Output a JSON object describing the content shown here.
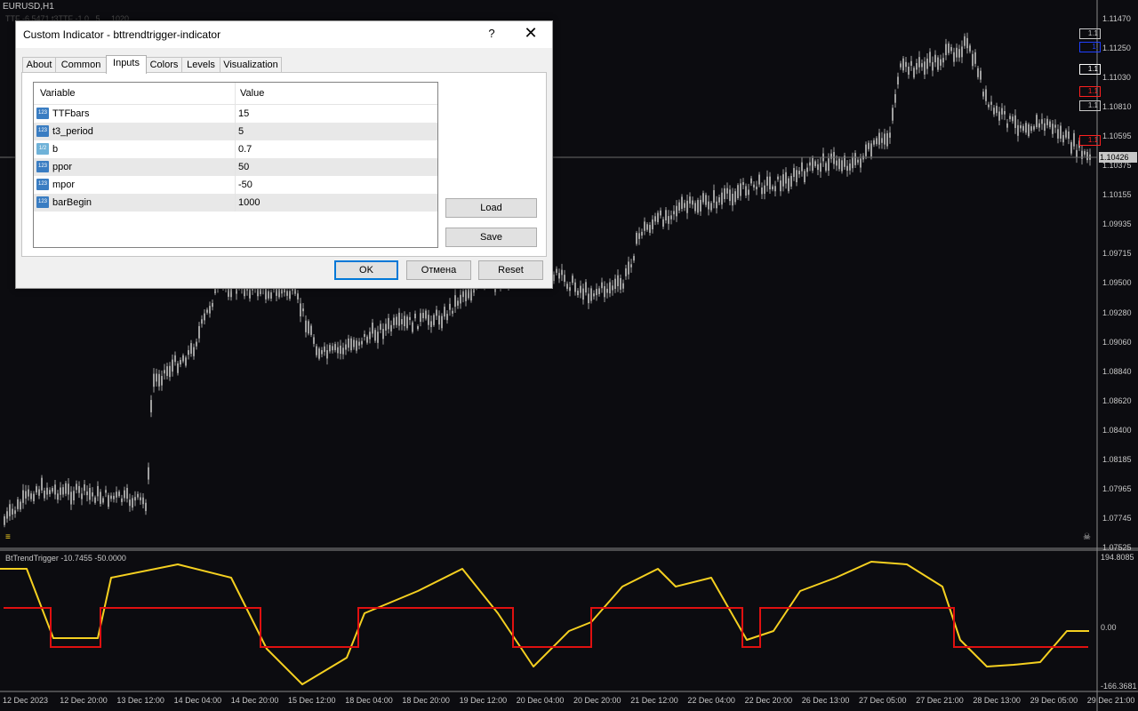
{
  "window": {
    "title": "EURUSD,H1",
    "faint_info": "TTF  -6.5471  t3TTF  -1.0...5  ...  1020"
  },
  "price_axis": [
    "1.11470",
    "1.11250",
    "1.11030",
    "1.10810",
    "1.10595",
    "1.10375",
    "1.10155",
    "1.09935",
    "1.09715",
    "1.09500",
    "1.09280",
    "1.09060",
    "1.08840",
    "1.08620",
    "1.08400",
    "1.08185",
    "1.07965",
    "1.07745",
    "1.07525"
  ],
  "current_price": "1.10426",
  "tags": [
    {
      "text": "1.1",
      "color": "#c8c8c8"
    },
    {
      "text": "1.",
      "color": "#2040ff"
    },
    {
      "text": "1.1",
      "color": "#ffffff"
    },
    {
      "text": "1.1",
      "color": "#ff2020"
    },
    {
      "text": "1.1",
      "color": "#c8c8c8"
    },
    {
      "text": "1.1",
      "color": "#ff2020"
    }
  ],
  "time_axis": [
    "12 Dec 2023",
    "12 Dec 20:00",
    "13 Dec 12:00",
    "14 Dec 04:00",
    "14 Dec 20:00",
    "15 Dec 12:00",
    "18 Dec 04:00",
    "18 Dec 20:00",
    "19 Dec 12:00",
    "20 Dec 04:00",
    "20 Dec 20:00",
    "21 Dec 12:00",
    "22 Dec 04:00",
    "22 Dec 20:00",
    "26 Dec 13:00",
    "27 Dec 05:00",
    "27 Dec 21:00",
    "28 Dec 13:00",
    "29 Dec 05:00",
    "29 Dec 21:00"
  ],
  "subwindow": {
    "title": "BtTrendTrigger -10.7455 -50.0000",
    "max_label": "194.8085",
    "zero_label": "0.00",
    "min_label": "-166.3681"
  },
  "colors": {
    "background": "#0c0c10",
    "candle": "#a0a0a0",
    "osc_line": "#f5d020",
    "trigger_line": "#e01010",
    "dialog_bg": "#f0f0f0",
    "default_button_border": "#0078d7"
  },
  "dialog": {
    "title": "Custom Indicator - bttrendtrigger-indicator",
    "help_label": "?",
    "close_label": "✕",
    "tabs": [
      {
        "label": "About",
        "active": false
      },
      {
        "label": "Common",
        "active": false
      },
      {
        "label": "Inputs",
        "active": true
      },
      {
        "label": "Colors",
        "active": false
      },
      {
        "label": "Levels",
        "active": false
      },
      {
        "label": "Visualization",
        "active": false
      }
    ],
    "grid": {
      "col_variable": "Variable",
      "col_value": "Value",
      "rows": [
        {
          "icon": "123",
          "name": "TTFbars",
          "value": "15"
        },
        {
          "icon": "123",
          "name": "t3_period",
          "value": "5"
        },
        {
          "icon": "1/2",
          "name": "b",
          "value": "0.7"
        },
        {
          "icon": "123",
          "name": "ppor",
          "value": "50"
        },
        {
          "icon": "123",
          "name": "mpor",
          "value": "-50"
        },
        {
          "icon": "123",
          "name": "barBegin",
          "value": "1000"
        }
      ]
    },
    "buttons": {
      "load": "Load",
      "save": "Save",
      "ok": "OK",
      "cancel": "Отмена",
      "reset": "Reset"
    }
  }
}
